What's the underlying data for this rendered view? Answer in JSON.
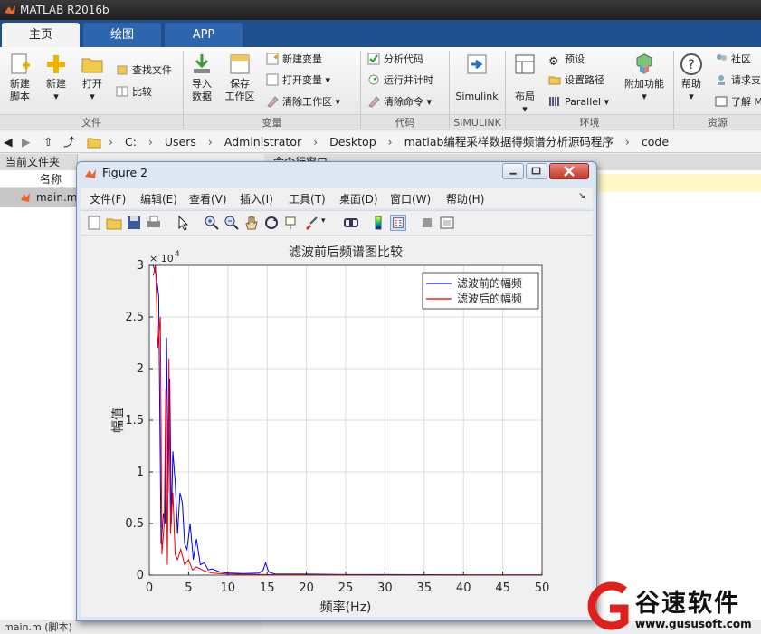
{
  "app": {
    "title": "MATLAB R2016b"
  },
  "tabs": [
    "主页",
    "绘图",
    "APP"
  ],
  "ribbon": {
    "new_script": [
      "新建",
      "脚本"
    ],
    "new": "新建",
    "open": "打开",
    "find_files": "查找文件",
    "compare": "比较",
    "import_data": [
      "导入",
      "数据"
    ],
    "save_workspace": [
      "保存",
      "工作区"
    ],
    "new_variable": "新建变量",
    "open_variable": "打开变量",
    "clear_workspace": "清除工作区",
    "analyze_code": "分析代码",
    "run_and_time": "运行并计时",
    "clear_commands": "清除命令",
    "simulink": "Simulink",
    "layout": "布局",
    "preferences": "预设",
    "set_path": "设置路径",
    "parallel": "Parallel",
    "addons": "附加功能",
    "help": "帮助",
    "community": "社区",
    "request_support": "请求支",
    "learn": "了解 M",
    "groups": {
      "file": "文件",
      "variable": "变量",
      "code": "代码",
      "simulink": "SIMULINK",
      "environment": "环境",
      "resources": "资源"
    }
  },
  "address": {
    "crumbs": [
      "C:",
      "Users",
      "Administrator",
      "Desktop",
      "matlab编程采样数据得频谱分析源码程序",
      "code"
    ],
    "separator": "›"
  },
  "current_folder": {
    "title": "当前文件夹",
    "column": "名称",
    "files": [
      "main.m"
    ],
    "status": "main.m  (脚本)"
  },
  "command_window": {
    "title": "命令行窗口"
  },
  "figure": {
    "title": "Figure 2",
    "menu": [
      "文件(F)",
      "编辑(E)",
      "查看(V)",
      "插入(I)",
      "工具(T)",
      "桌面(D)",
      "窗口(W)",
      "帮助(H)"
    ]
  },
  "chart_data": {
    "type": "line",
    "title": "滤波前后频谱图比较",
    "xlabel": "频率(Hz)",
    "ylabel": "幅值",
    "y_multiplier": "× 10^4",
    "xlim": [
      0,
      50
    ],
    "ylim": [
      0,
      3
    ],
    "xticks": [
      0,
      5,
      10,
      15,
      20,
      25,
      30,
      35,
      40,
      45,
      50
    ],
    "yticks": [
      0,
      0.5,
      1,
      1.5,
      2,
      2.5,
      3
    ],
    "grid": true,
    "legend_position": "top-right",
    "series": [
      {
        "name": "滤波前的幅频",
        "color": "#0000ee",
        "x": [
          0.5,
          0.9,
          1.2,
          1.5,
          1.8,
          2.0,
          2.2,
          2.4,
          2.6,
          2.8,
          3.0,
          3.3,
          3.6,
          3.9,
          4.2,
          4.5,
          4.8,
          5.2,
          5.6,
          6.0,
          6.5,
          7.0,
          7.5,
          8.0,
          9.0,
          10.0,
          12.0,
          14.0,
          14.5,
          14.8,
          15.2,
          16.0,
          20.0,
          25.0,
          30.0,
          35.0,
          40.0,
          45.0,
          50.0
        ],
        "y": [
          3.0,
          2.9,
          2.7,
          0.3,
          0.6,
          0.5,
          2.3,
          0.8,
          1.9,
          0.5,
          1.2,
          0.9,
          0.4,
          0.8,
          0.7,
          0.3,
          0.25,
          0.5,
          0.15,
          0.35,
          0.1,
          0.12,
          0.05,
          0.06,
          0.03,
          0.02,
          0.015,
          0.02,
          0.05,
          0.12,
          0.03,
          0.01,
          0.01,
          0.005,
          0.005,
          0.004,
          0.003,
          0.003,
          0.003
        ]
      },
      {
        "name": "滤波后的幅频",
        "color": "#ee0000",
        "x": [
          0.5,
          0.8,
          1.1,
          1.4,
          1.6,
          1.9,
          2.1,
          2.3,
          2.5,
          2.7,
          3.0,
          3.3,
          3.6,
          4.0,
          4.5,
          5.0,
          5.5,
          6.0,
          7.0,
          8.0,
          10.0,
          15.0,
          20.0,
          30.0,
          40.0,
          50.0
        ],
        "y": [
          2.9,
          3.0,
          2.2,
          2.5,
          0.2,
          0.5,
          1.8,
          0.1,
          2.1,
          0.4,
          0.8,
          0.2,
          0.15,
          0.25,
          0.1,
          0.15,
          0.05,
          0.08,
          0.04,
          0.02,
          0.01,
          0.005,
          0.004,
          0.003,
          0.003,
          0.003
        ]
      }
    ]
  },
  "watermark": {
    "text": "谷速软件",
    "url": "www.gususoft.com"
  }
}
